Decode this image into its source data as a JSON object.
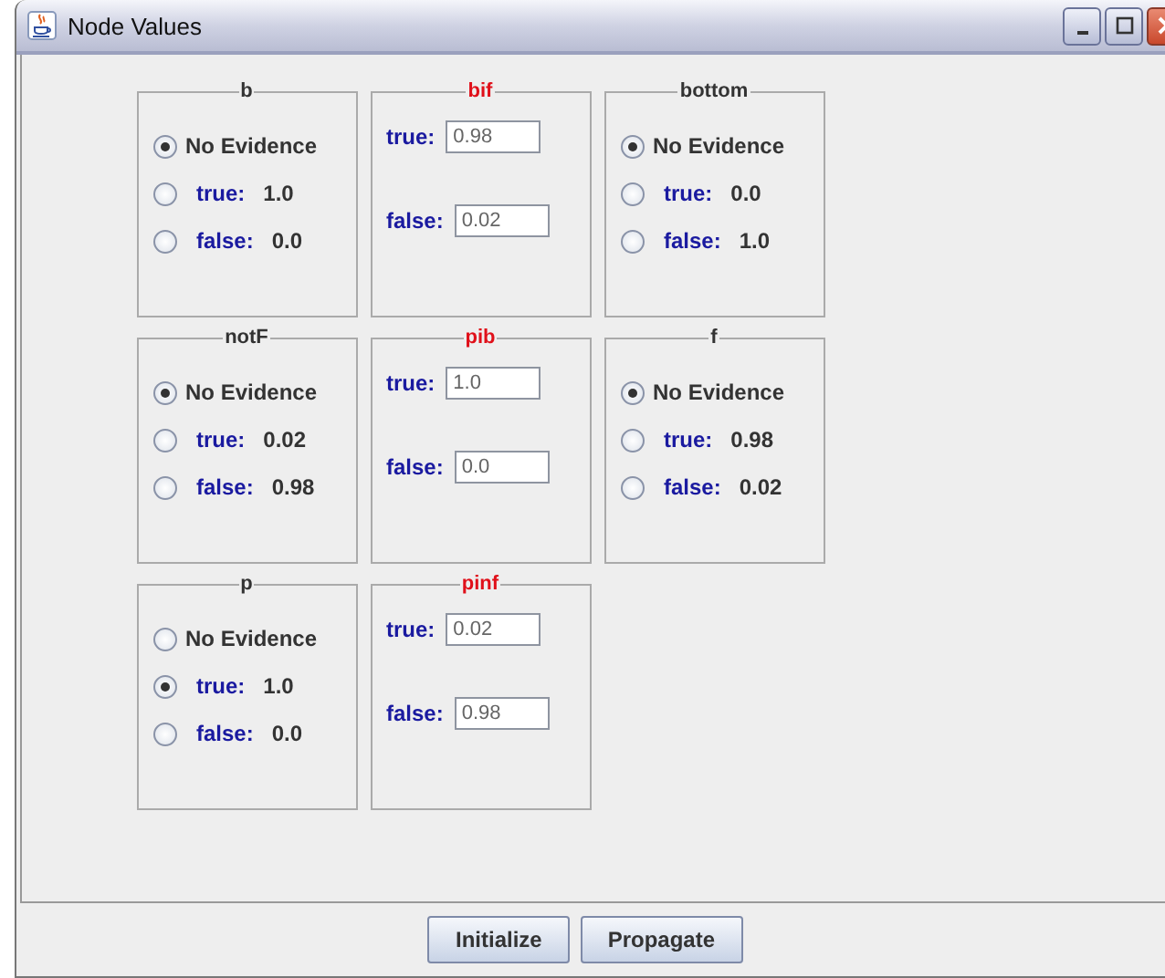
{
  "window": {
    "title": "Node Values"
  },
  "nodes": [
    {
      "kind": "evidence",
      "title": "b",
      "options": [
        {
          "label": "No Evidence",
          "selected": true
        },
        {
          "label": "true:",
          "value": "1.0",
          "selected": false
        },
        {
          "label": "false:",
          "value": "0.0",
          "selected": false
        }
      ]
    },
    {
      "kind": "table",
      "title": "bif",
      "rows": [
        {
          "label": "true:",
          "value": "0.98"
        },
        {
          "label": "false:",
          "value": "0.02"
        }
      ]
    },
    {
      "kind": "evidence",
      "title": "bottom",
      "options": [
        {
          "label": "No Evidence",
          "selected": true
        },
        {
          "label": "true:",
          "value": "0.0",
          "selected": false
        },
        {
          "label": "false:",
          "value": "1.0",
          "selected": false
        }
      ]
    },
    {
      "kind": "evidence",
      "title": "notF",
      "options": [
        {
          "label": "No Evidence",
          "selected": true
        },
        {
          "label": "true:",
          "value": "0.02",
          "selected": false
        },
        {
          "label": "false:",
          "value": "0.98",
          "selected": false
        }
      ]
    },
    {
      "kind": "table",
      "title": "pib",
      "rows": [
        {
          "label": "true:",
          "value": "1.0"
        },
        {
          "label": "false:",
          "value": "0.0"
        }
      ]
    },
    {
      "kind": "evidence",
      "title": "f",
      "options": [
        {
          "label": "No Evidence",
          "selected": true
        },
        {
          "label": "true:",
          "value": "0.98",
          "selected": false
        },
        {
          "label": "false:",
          "value": "0.02",
          "selected": false
        }
      ]
    },
    {
      "kind": "evidence",
      "title": "p",
      "options": [
        {
          "label": "No Evidence",
          "selected": false
        },
        {
          "label": "true:",
          "value": "1.0",
          "selected": true
        },
        {
          "label": "false:",
          "value": "0.0",
          "selected": false
        }
      ]
    },
    {
      "kind": "table",
      "title": "pinf",
      "rows": [
        {
          "label": "true:",
          "value": "0.02"
        },
        {
          "label": "false:",
          "value": "0.98"
        }
      ]
    }
  ],
  "buttons": [
    "Initialize",
    "Propagate"
  ]
}
